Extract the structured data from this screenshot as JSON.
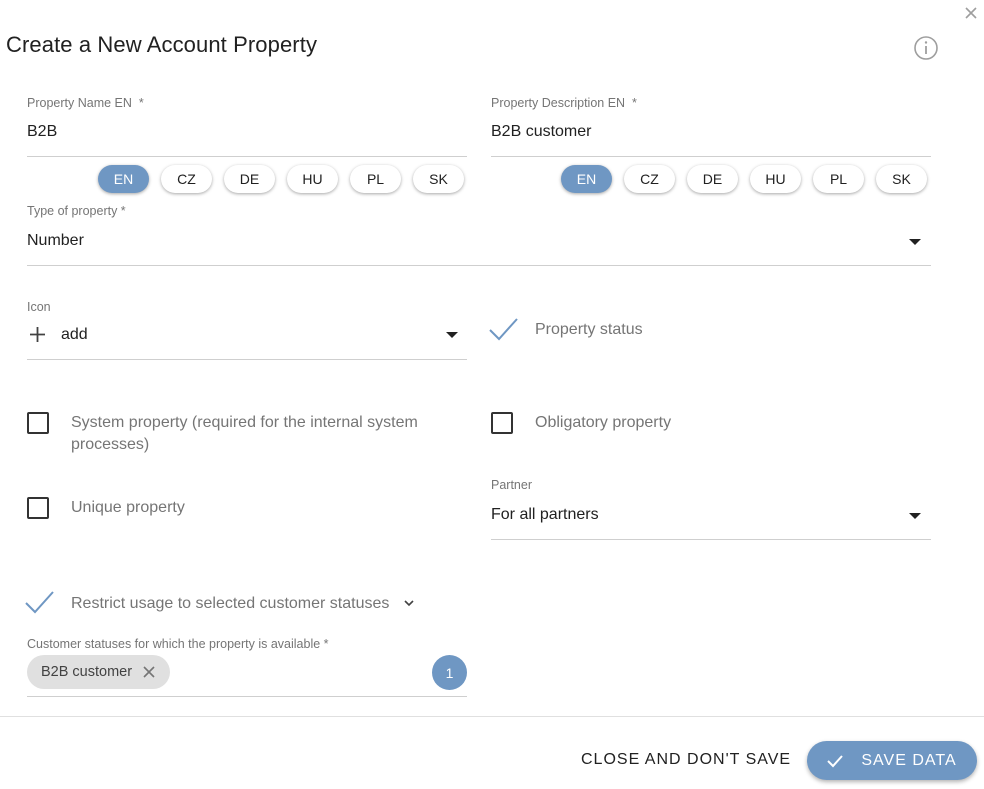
{
  "dialog": {
    "title": "Create a New Account Property"
  },
  "property_name": {
    "label": "Property Name EN",
    "required_mark": "*",
    "value": "B2B",
    "languages": [
      "EN",
      "CZ",
      "DE",
      "HU",
      "PL",
      "SK"
    ],
    "active_language": "EN"
  },
  "property_description": {
    "label": "Property Description EN",
    "required_mark": "*",
    "value": "B2B customer",
    "languages": [
      "EN",
      "CZ",
      "DE",
      "HU",
      "PL",
      "SK"
    ],
    "active_language": "EN"
  },
  "type_of_property": {
    "label": "Type of property *",
    "value": "Number"
  },
  "icon_field": {
    "label": "Icon",
    "icon_name": "add-icon",
    "value": "add"
  },
  "property_status": {
    "label": "Property status",
    "checked": true
  },
  "system_property": {
    "label_line1": "System property (required for the internal system",
    "label_line2": "processes)",
    "checked": false
  },
  "obligatory_property": {
    "label": "Obligatory property",
    "checked": false
  },
  "unique_property": {
    "label": "Unique property",
    "checked": false
  },
  "partner": {
    "label": "Partner",
    "value": "For all partners"
  },
  "restrict_usage": {
    "label": "Restrict usage to selected customer statuses",
    "checked": true
  },
  "customer_statuses": {
    "label": "Customer statuses for which the property is available *",
    "chips": [
      "B2B customer"
    ],
    "count": "1"
  },
  "footer": {
    "close_label": "CLOSE AND DON'T SAVE",
    "save_label": "SAVE DATA"
  },
  "colors": {
    "accent": "#6f97c3",
    "label_gray": "#757575",
    "divider": "#cfcfcf"
  }
}
